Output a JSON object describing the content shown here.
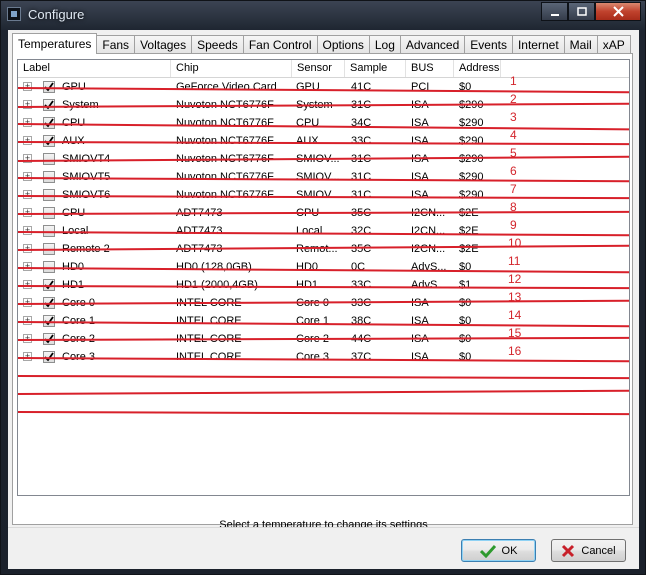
{
  "window": {
    "title": "Configure"
  },
  "tabs": [
    {
      "label": "Temperatures",
      "active": true
    },
    {
      "label": "Fans"
    },
    {
      "label": "Voltages"
    },
    {
      "label": "Speeds"
    },
    {
      "label": "Fan Control"
    },
    {
      "label": "Options"
    },
    {
      "label": "Log"
    },
    {
      "label": "Advanced"
    },
    {
      "label": "Events"
    },
    {
      "label": "Internet"
    },
    {
      "label": "Mail"
    },
    {
      "label": "xAP"
    }
  ],
  "table": {
    "columns": [
      "Label",
      "Chip",
      "Sensor",
      "Sample",
      "BUS",
      "Address"
    ],
    "rows": [
      {
        "checked": true,
        "label": "GPU",
        "chip": "GeForce Video Card",
        "sensor": "GPU",
        "sample": "41C",
        "bus": "PCI",
        "address": "$0",
        "marker": "1"
      },
      {
        "checked": true,
        "label": "System",
        "chip": "Nuvoton NCT6776F",
        "sensor": "System",
        "sample": "31C",
        "bus": "ISA",
        "address": "$290",
        "marker": "2"
      },
      {
        "checked": true,
        "label": "CPU",
        "chip": "Nuvoton NCT6776F",
        "sensor": "CPU",
        "sample": "34C",
        "bus": "ISA",
        "address": "$290",
        "marker": "3"
      },
      {
        "checked": true,
        "label": "AUX",
        "chip": "Nuvoton NCT6776F",
        "sensor": "AUX",
        "sample": "33C",
        "bus": "ISA",
        "address": "$290",
        "marker": "4"
      },
      {
        "checked": false,
        "label": "SMIOVT4",
        "chip": "Nuvoton NCT6776F",
        "sensor": "SMIOV...",
        "sample": "31C",
        "bus": "ISA",
        "address": "$290",
        "marker": "5"
      },
      {
        "checked": false,
        "label": "SMIOVT5",
        "chip": "Nuvoton NCT6776F",
        "sensor": "SMIOV...",
        "sample": "31C",
        "bus": "ISA",
        "address": "$290",
        "marker": "6"
      },
      {
        "checked": false,
        "label": "SMIOVT6",
        "chip": "Nuvoton NCT6776F",
        "sensor": "SMIOV...",
        "sample": "31C",
        "bus": "ISA",
        "address": "$290",
        "marker": "7"
      },
      {
        "checked": false,
        "label": "CPU",
        "chip": "ADT7473",
        "sensor": "CPU",
        "sample": "35C",
        "bus": "I2CN...",
        "address": "$2E",
        "marker": "8"
      },
      {
        "checked": false,
        "label": "Local",
        "chip": "ADT7473",
        "sensor": "Local",
        "sample": "32C",
        "bus": "I2CN...",
        "address": "$2E",
        "marker": "9"
      },
      {
        "checked": false,
        "label": "Remote 2",
        "chip": "ADT7473",
        "sensor": "Remot...",
        "sample": "35C",
        "bus": "I2CN...",
        "address": "$2E",
        "marker": "10"
      },
      {
        "checked": false,
        "label": "HD0",
        "chip": "HD0 (128,0GB)",
        "sensor": "HD0",
        "sample": "0C",
        "bus": "AdvS...",
        "address": "$0",
        "marker": "11"
      },
      {
        "checked": true,
        "label": "HD1",
        "chip": "HD1 (2000,4GB)",
        "sensor": "HD1",
        "sample": "33C",
        "bus": "AdvS...",
        "address": "$1",
        "marker": "12"
      },
      {
        "checked": true,
        "label": "Core 0",
        "chip": "INTEL CORE",
        "sensor": "Core 0",
        "sample": "33C",
        "bus": "ISA",
        "address": "$0",
        "marker": "13"
      },
      {
        "checked": true,
        "label": "Core 1",
        "chip": "INTEL CORE",
        "sensor": "Core 1",
        "sample": "38C",
        "bus": "ISA",
        "address": "$0",
        "marker": "14"
      },
      {
        "checked": true,
        "label": "Core 2",
        "chip": "INTEL CORE",
        "sensor": "Core 2",
        "sample": "44C",
        "bus": "ISA",
        "address": "$0",
        "marker": "15"
      },
      {
        "checked": true,
        "label": "Core 3",
        "chip": "INTEL CORE",
        "sensor": "Core 3",
        "sample": "37C",
        "bus": "ISA",
        "address": "$0",
        "marker": "16"
      }
    ]
  },
  "status": "Select a temperature to change its settings",
  "buttons": {
    "ok": "OK",
    "cancel": "Cancel"
  },
  "colors": {
    "annotation": "#d8202a",
    "ok_icon": "#2e9a2e",
    "cancel_icon": "#c8202a"
  },
  "icons": {
    "expander": "plus-box-icon",
    "checkbox_checked": "check-mark-icon",
    "ok": "check-icon",
    "cancel": "x-icon"
  }
}
